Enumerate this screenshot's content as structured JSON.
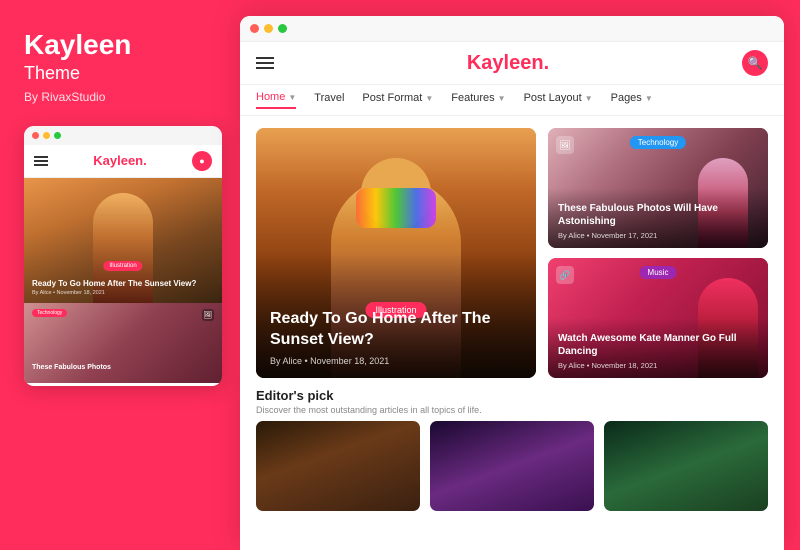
{
  "leftPanel": {
    "brand": {
      "title": "Kayleen",
      "subtitle": "Theme",
      "by": "By RivaxStudio"
    },
    "miniBrowser": {
      "logo": "Kayleen",
      "logoDot": ".",
      "heroBadge": "Illustration",
      "heroTitle": "Ready To Go Home After The Sunset View?",
      "heroMeta": "By Alice  •  November 18, 2021",
      "card2Badge": "Technology",
      "card2Title": "These Fabulous Photos"
    }
  },
  "rightPanel": {
    "browserDots": [
      "dot-red",
      "dot-yellow",
      "dot-green"
    ],
    "header": {
      "logo": "Kayleen",
      "logoDot": "."
    },
    "nav": {
      "items": [
        {
          "label": "Home",
          "active": true,
          "hasArrow": true
        },
        {
          "label": "Travel",
          "active": false,
          "hasArrow": false
        },
        {
          "label": "Post Format",
          "active": false,
          "hasArrow": true
        },
        {
          "label": "Features",
          "active": false,
          "hasArrow": true
        },
        {
          "label": "Post Layout",
          "active": false,
          "hasArrow": true
        },
        {
          "label": "Pages",
          "active": false,
          "hasArrow": true
        }
      ]
    },
    "heroArticle": {
      "badge": "Illustration",
      "title": "Ready To Go Home After The Sunset View?",
      "metaAuthor": "By Alice",
      "metaDate": "November 18, 2021"
    },
    "sideCards": [
      {
        "badgeLabel": "Technology",
        "badgeClass": "badge-technology",
        "title": "These Fabulous Photos Will Have Astonishing",
        "metaAuthor": "By Alice",
        "metaDate": "November 17, 2021",
        "icon": "🖼"
      },
      {
        "badgeLabel": "Music",
        "badgeClass": "badge-music",
        "title": "Watch Awesome Kate Manner Go Full Dancing",
        "metaAuthor": "By Alice",
        "metaDate": "November 18, 2021",
        "icon": "🔗"
      }
    ],
    "editorsPick": {
      "title": "Editor's pick",
      "subtitle": "Discover the most outstanding articles in all topics of life."
    }
  }
}
